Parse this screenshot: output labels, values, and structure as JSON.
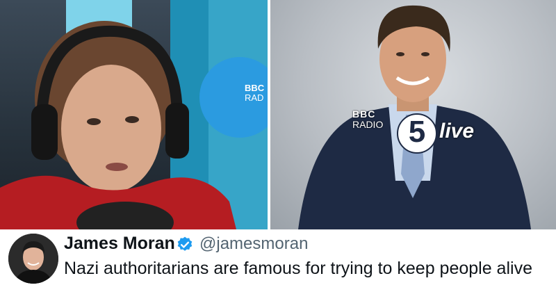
{
  "left_image": {
    "logo_top": "BBC",
    "logo_bottom": "RAD"
  },
  "right_image": {
    "logo_bbc": "BBC",
    "logo_radio": "RADIO",
    "logo_number": "5",
    "logo_live": "live"
  },
  "tweet": {
    "name": "James Moran",
    "handle": "@jamesmoran",
    "text": "Nazi authoritarians are famous for trying to keep people alive"
  },
  "colors": {
    "verified": "#1d9bf0",
    "name": "#0f1419",
    "handle": "#536471"
  }
}
